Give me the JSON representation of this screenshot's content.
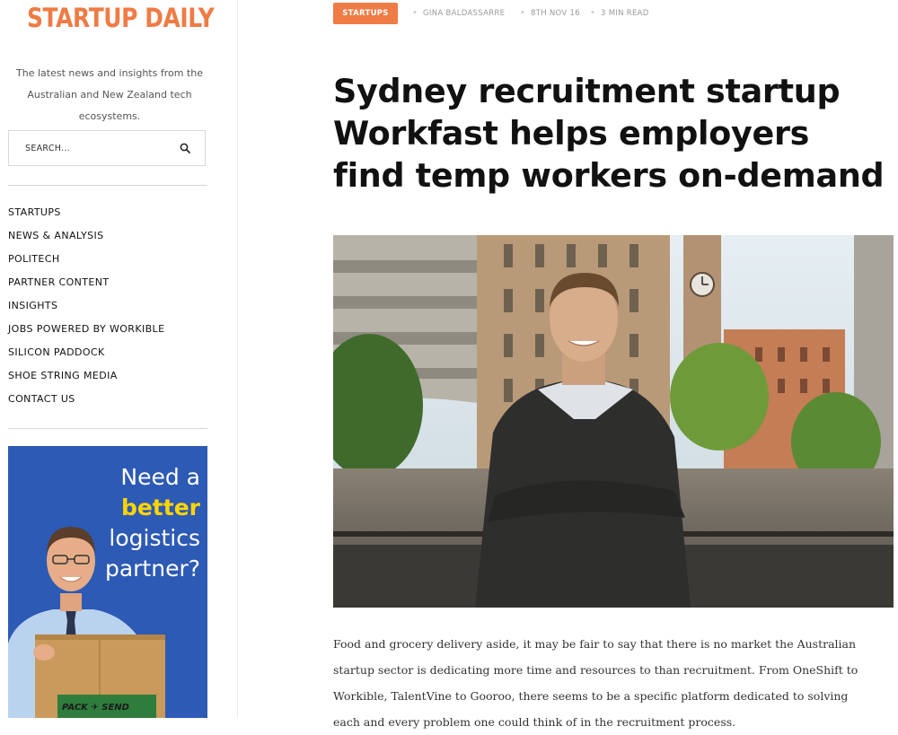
{
  "site": {
    "logo": "STARTUP DAILY",
    "tagline": "The latest news and insights from the Australian and New Zealand tech ecosystems."
  },
  "search": {
    "placeholder": "SEARCH...",
    "icon": "search-icon"
  },
  "nav": {
    "items": [
      "STARTUPS",
      "NEWS & ANALYSIS",
      "POLITECH",
      "PARTNER CONTENT",
      "INSIGHTS",
      "JOBS POWERED BY WORKIBLE",
      "SILICON PADDOCK",
      "SHOE STRING MEDIA",
      "CONTACT US"
    ]
  },
  "ad": {
    "line1": "Need a",
    "line2": "better",
    "line3": "logistics",
    "line4": "partner?",
    "box_label": "PACK ✈ SEND",
    "background_color": "#2d5ab4",
    "highlight_color": "#ffd500"
  },
  "article": {
    "category": "STARTUPS",
    "author": "GINA BALDASSARRE",
    "date": "8TH NOV 16",
    "read_time": "3 MIN READ",
    "title": "Sydney recruitment startup Workfast helps employers find temp workers on-demand",
    "body": "Food and grocery delivery aside, it may be fair to say that there is no market the Australian startup sector is dedicating more time and resources to than recruitment. From OneShift to Workible, TalentVine to Gooroo, there seems to be a specific platform dedicated to solving each and every problem one could think of in the recruitment process."
  },
  "colors": {
    "accent": "#ef7b45",
    "text": "#111111",
    "muted": "#999999"
  }
}
